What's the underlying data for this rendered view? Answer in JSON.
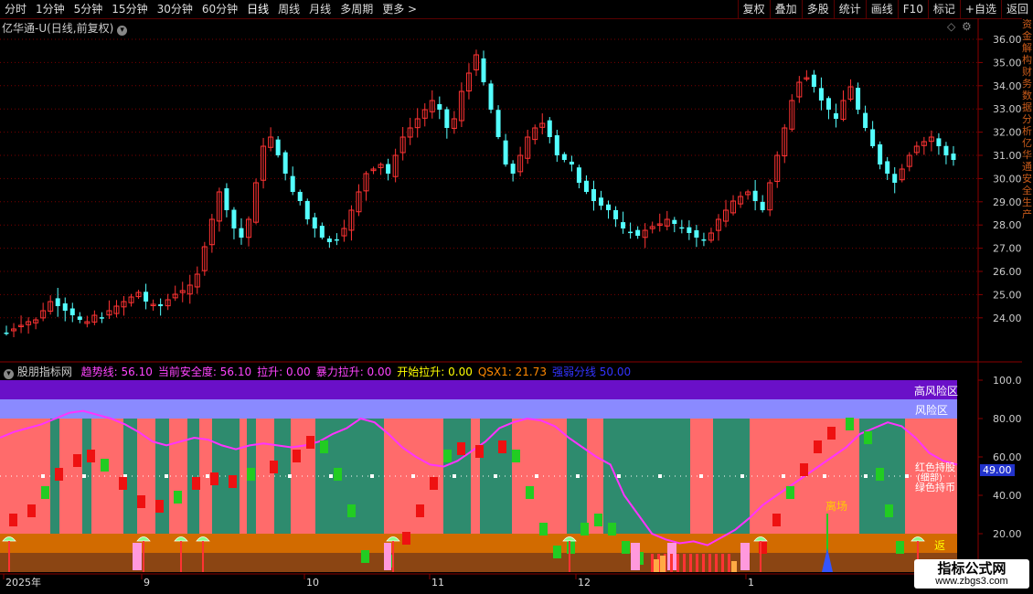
{
  "toolbar": {
    "periods": [
      "分时",
      "1分钟",
      "5分钟",
      "15分钟",
      "30分钟",
      "60分钟",
      "日线",
      "周线",
      "月线",
      "多周期",
      "更多 >"
    ],
    "active_period": "日线",
    "tools": [
      "复权",
      "叠加",
      "多股",
      "统计",
      "画线",
      "F10",
      "标记",
      "+自选",
      "返回"
    ]
  },
  "main_panel": {
    "title": "亿华通-U(日线,前复权)",
    "price_axis": [
      "36.00",
      "35.00",
      "34.00",
      "33.00",
      "32.00",
      "31.00",
      "30.00",
      "29.00",
      "28.00",
      "27.00",
      "26.00",
      "25.00",
      "24.00"
    ],
    "colors": {
      "up": "#ff3333",
      "down": "#54ffff"
    }
  },
  "indicator_panel": {
    "name": "股朋指标网",
    "readouts": [
      {
        "label": "趋势线:",
        "value": "56.10",
        "color": "#ff44ff"
      },
      {
        "label": "当前安全度:",
        "value": "56.10",
        "color": "#ff44ff"
      },
      {
        "label": "拉升:",
        "value": "0.00",
        "color": "#ff44ff"
      },
      {
        "label": "暴力拉升:",
        "value": "0.00",
        "color": "#ff44ff"
      },
      {
        "label": "开始拉升:",
        "value": "0.00",
        "color": "#ffff00"
      },
      {
        "label": "QSX1:",
        "value": "21.73",
        "color": "#ff8800"
      },
      {
        "label": "强弱分线",
        "value": "50.00",
        "color": "#3333ff"
      }
    ],
    "axis": [
      "100.0",
      "80.00",
      "60.00",
      "40.00",
      "20.00"
    ],
    "current_value": "49.00",
    "zones": {
      "high_risk": "高风险区",
      "risk": "风险区"
    },
    "legend": {
      "red_hold": "红色持股",
      "green_exit": "绿色持币",
      "partial": "(细部)"
    },
    "exit_label": "离场",
    "return_label": "返"
  },
  "timeline": [
    "2025年",
    "9",
    "10",
    "11",
    "12",
    "1"
  ],
  "right_strip": "资金解构财务数据分析亿华通安全生产",
  "watermark": {
    "name": "指标公式网",
    "url": "www.zbgs3.com"
  }
}
